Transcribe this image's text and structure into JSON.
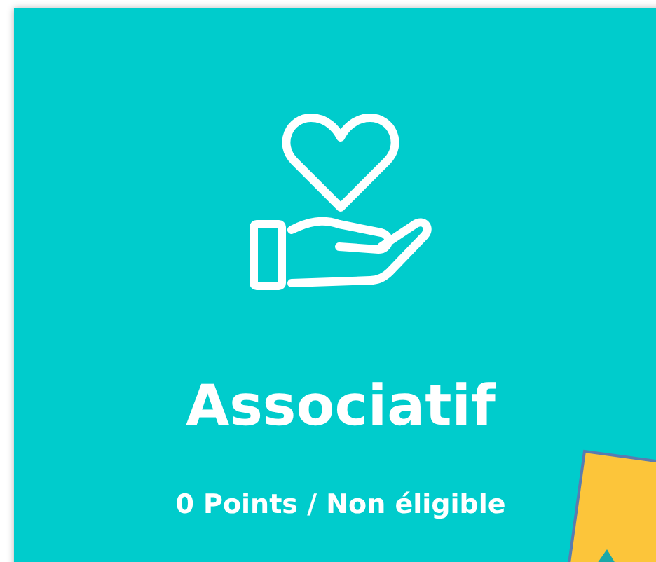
{
  "card": {
    "title": "Associatif",
    "subtitle": "0 Points / Non éligible"
  }
}
